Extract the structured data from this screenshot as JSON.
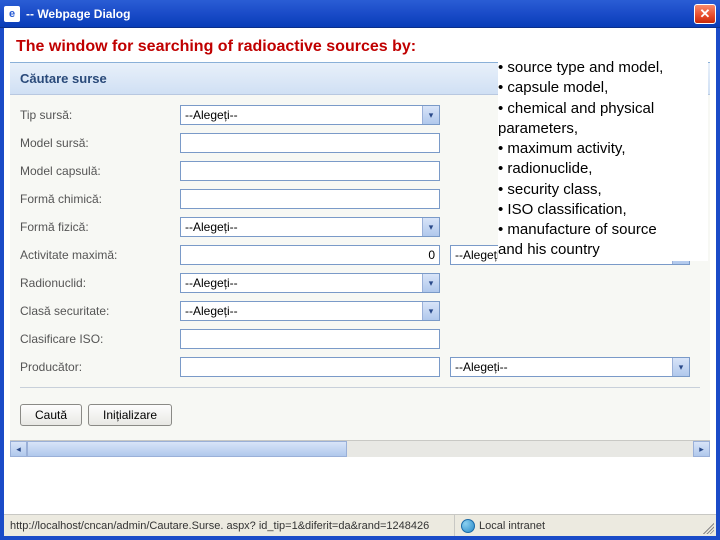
{
  "titlebar": {
    "title": "-- Webpage Dialog",
    "close": "✕"
  },
  "caption": "The window for searching of radioactive sources by:",
  "bullets": [
    "• source type and model,",
    "• capsule model,",
    "• chemical and physical",
    "parameters,",
    "• maximum activity,",
    "• radionuclide,",
    "• security class,",
    "• ISO classification,",
    "• manufacture of source",
    "and his country"
  ],
  "panel": {
    "header": "Căutare surse"
  },
  "form": {
    "tip_sursa": {
      "label": "Tip sursă:",
      "placeholder": "--Alegeți--"
    },
    "model_sursa": {
      "label": "Model sursă:",
      "value": ""
    },
    "model_capsula": {
      "label": "Model capsulă:",
      "value": ""
    },
    "forma_chimica": {
      "label": "Formă chimică:",
      "value": ""
    },
    "forma_fizica": {
      "label": "Formă fizică:",
      "placeholder": "--Alegeți--"
    },
    "activitate_maxima": {
      "label": "Activitate maximă:",
      "value": "0",
      "unit_placeholder": "--Alegeți--"
    },
    "radionuclid": {
      "label": "Radionuclid:",
      "placeholder": "--Alegeți--"
    },
    "clasa_securitate": {
      "label": "Clasă securitate:",
      "placeholder": "--Alegeți--"
    },
    "clasificare_iso": {
      "label": "Clasificare ISO:",
      "value": ""
    },
    "producator": {
      "label": "Producător:",
      "value": "",
      "picker_placeholder": "--Alegeți--"
    }
  },
  "buttons": {
    "search": "Caută",
    "reset": "Inițializare"
  },
  "statusbar": {
    "url": "http://localhost/cncan/admin/Cautare.Surse. aspx? id_tip=1&diferit=da&rand=1248426",
    "zone": "Local intranet"
  }
}
